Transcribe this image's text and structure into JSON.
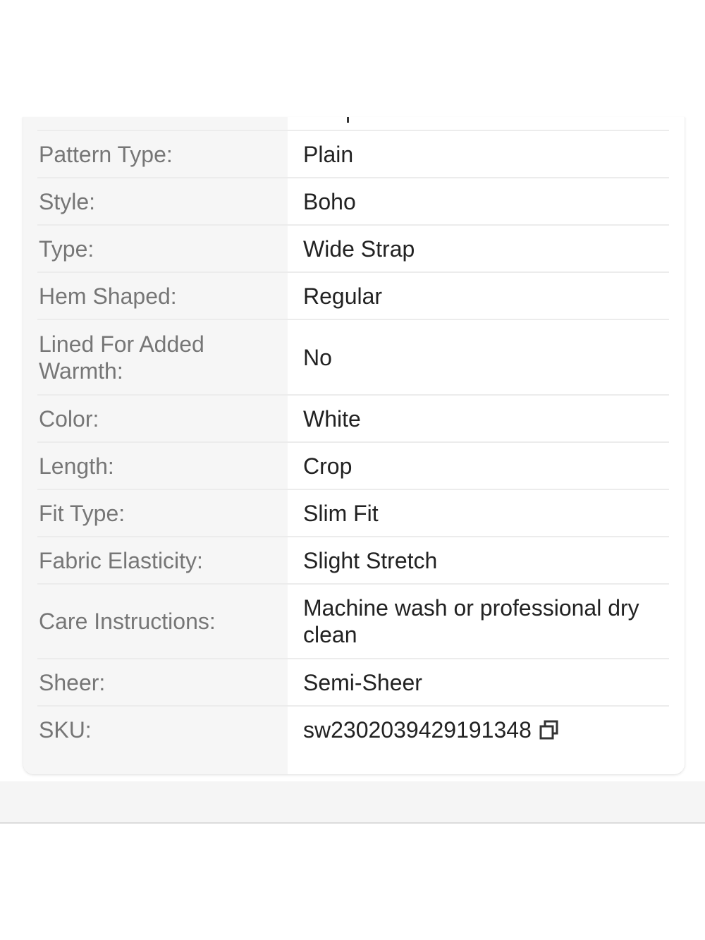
{
  "specs": [
    {
      "label": "Pattern Type:",
      "value": "Plain"
    },
    {
      "label": "Style:",
      "value": "Boho"
    },
    {
      "label": "Type:",
      "value": "Wide Strap"
    },
    {
      "label": "Hem Shaped:",
      "value": "Regular"
    },
    {
      "label": "Lined For Added Warmth:",
      "value": "No"
    },
    {
      "label": "Color:",
      "value": "White"
    },
    {
      "label": "Length:",
      "value": "Crop"
    },
    {
      "label": "Fit Type:",
      "value": "Slim Fit"
    },
    {
      "label": "Fabric Elasticity:",
      "value": "Slight Stretch"
    },
    {
      "label": "Care Instructions:",
      "value": "Machine wash or professional dry clean"
    },
    {
      "label": "Sheer:",
      "value": "Semi-Sheer"
    },
    {
      "label": "SKU:",
      "value": "sw2302039429191348"
    }
  ],
  "icons": {
    "sku_copy": "copy-icon"
  },
  "colors": {
    "label_text": "#767676",
    "value_text": "#222222",
    "label_column_bg": "#f6f6f6",
    "divider": "#ececec"
  }
}
